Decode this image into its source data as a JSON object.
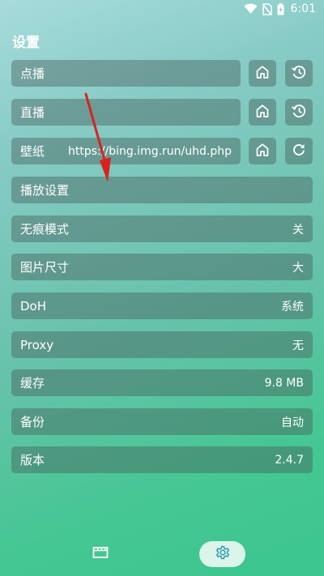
{
  "status_bar": {
    "time": "6:01"
  },
  "page": {
    "title": "设置"
  },
  "settings": {
    "vod": {
      "label": "点播"
    },
    "live": {
      "label": "直播"
    },
    "wallpaper": {
      "label": "壁纸",
      "url": "https://bing.img.run/uhd.php"
    },
    "playback": {
      "label": "播放设置"
    },
    "incognito": {
      "label": "无痕模式",
      "value": "关"
    },
    "image_size": {
      "label": "图片尺寸",
      "value": "大"
    },
    "doh": {
      "label": "DoH",
      "value": "系统"
    },
    "proxy": {
      "label": "Proxy",
      "value": "无"
    },
    "cache": {
      "label": "缓存",
      "value": "9.8 MB"
    },
    "backup": {
      "label": "备份",
      "value": "自动"
    },
    "version": {
      "label": "版本",
      "value": "2.4.7"
    }
  },
  "icons": {
    "home": "home-icon",
    "history": "history-icon",
    "refresh": "refresh-icon",
    "film": "film-icon",
    "settings": "gear-icon"
  },
  "colors": {
    "annotation_arrow": "#d8231f",
    "selected_nav_icon": "#2e9bb0"
  }
}
